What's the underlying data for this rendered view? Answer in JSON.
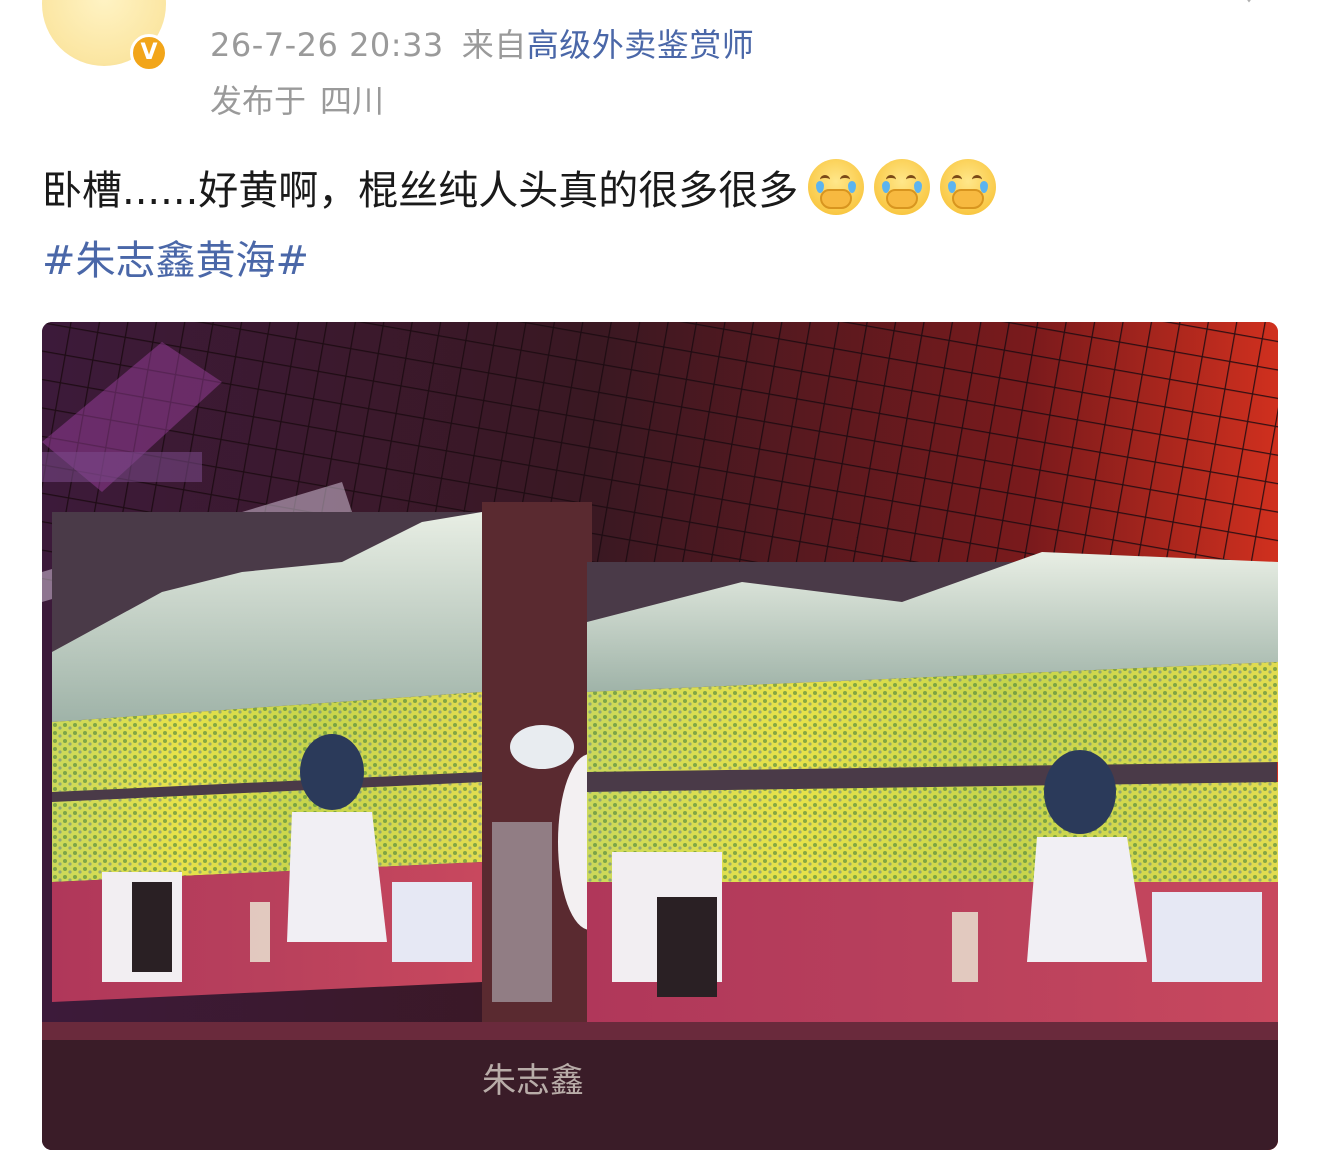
{
  "post": {
    "timestamp": "26-7-26 20:33",
    "from_label": "来自",
    "source_app": "高级外卖鉴赏师",
    "location_label": "发布于",
    "location": "四川",
    "text": "卧槽......好黄啊，棍丝纯人头真的很多很多",
    "emojis": [
      "cry-covering-mouth-emoji",
      "cry-covering-mouth-emoji",
      "cry-covering-mouth-emoji"
    ],
    "hashtag": "#朱志鑫黄海#",
    "image_watermark": "朱志鑫"
  },
  "avatar": {
    "badge": "V",
    "badge_color": "#f2a519"
  },
  "colors": {
    "meta_gray": "#9a9a9a",
    "link_blue": "#4a67a8",
    "text": "#1a1a1a",
    "stage_red": "#c42a1e",
    "crowd_yellow": "#e6e04a"
  }
}
